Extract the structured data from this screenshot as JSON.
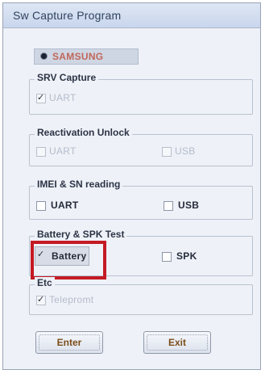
{
  "window": {
    "title": "Sw Capture Program"
  },
  "model": {
    "label": "SAMSUNG"
  },
  "groups": {
    "srv_capture": {
      "title": "SRV Capture",
      "uart": "UART"
    },
    "reactivation_unlock": {
      "title": "Reactivation Unlock",
      "uart": "UART",
      "usb": "USB"
    },
    "imei_sn_reading": {
      "title": "IMEI & SN reading",
      "uart": "UART",
      "usb": "USB"
    },
    "battery_spk_test": {
      "title": "Battery & SPK Test",
      "battery": "Battery",
      "spk": "SPK"
    },
    "etc": {
      "title": "Etc",
      "item": "Telepromt"
    }
  },
  "buttons": {
    "enter": "Enter",
    "exit": "Exit"
  },
  "colors": {
    "highlight": "#c41a24",
    "button_text": "#7c4d1a"
  }
}
